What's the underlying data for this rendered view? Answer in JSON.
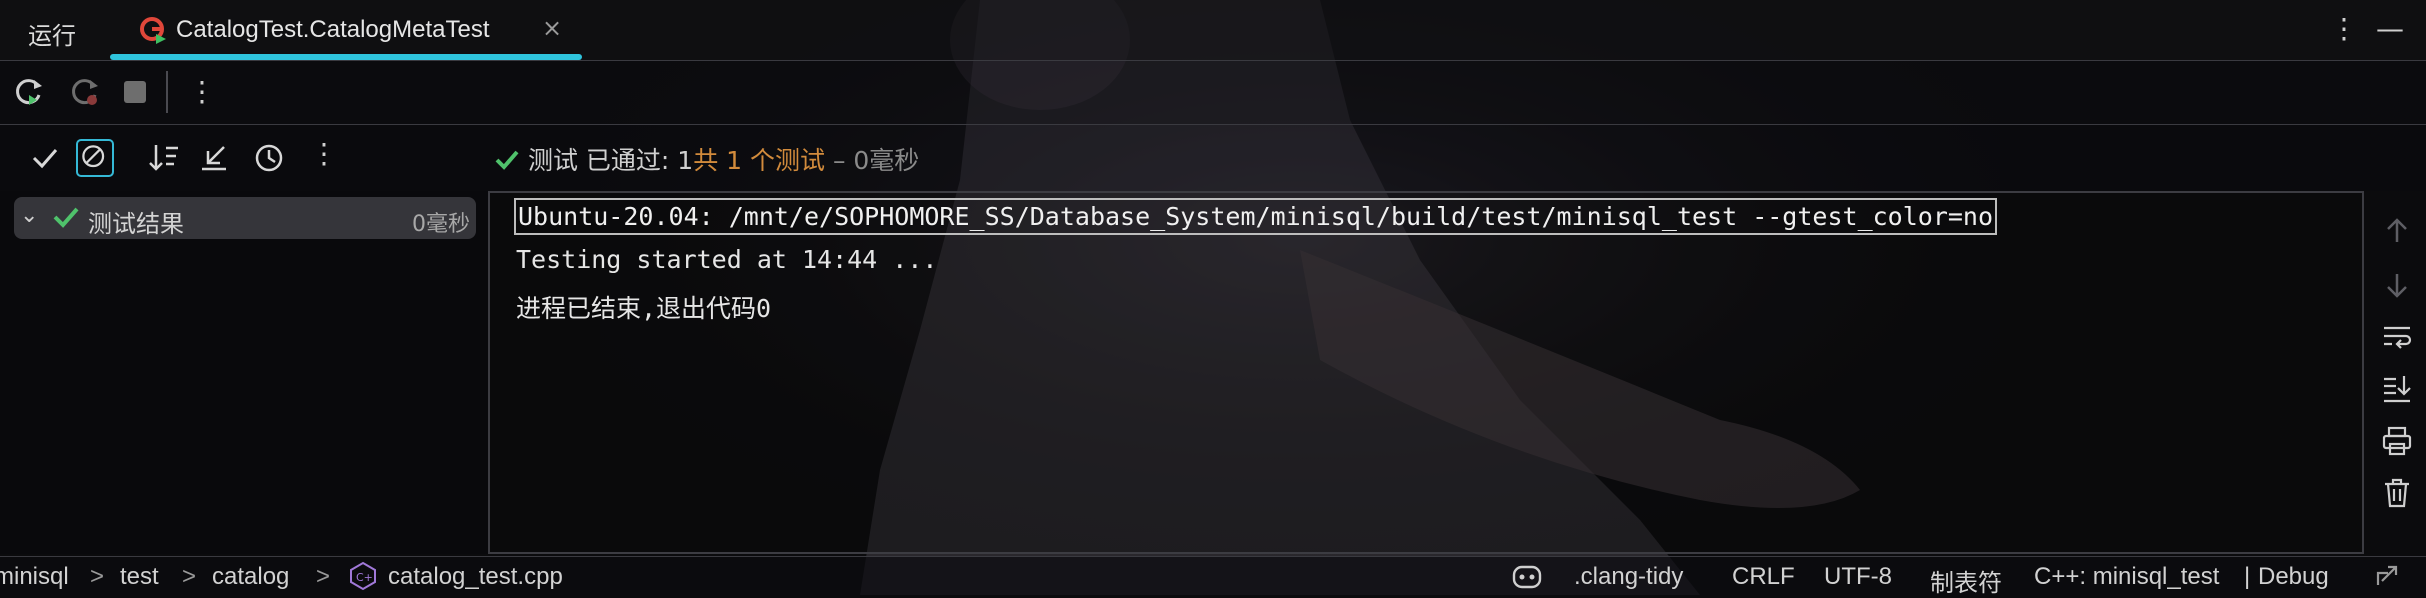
{
  "header": {
    "run_label": "运行",
    "tab_label": "CatalogTest.CatalogMetaTest",
    "tab_close": "×",
    "more_icon": "⋮",
    "minimize_icon": "—"
  },
  "toolbar": {
    "more_icon": "⋮"
  },
  "testbar": {
    "more_icon": "⋮",
    "status_passed": "测试 已通过: 1",
    "status_total": "共 1 个测试",
    "status_time": " – 0毫秒"
  },
  "tree": {
    "chevron": "⌄",
    "root_label": "测试结果",
    "root_time": "0毫秒"
  },
  "console": {
    "command": "Ubuntu-20.04: /mnt/e/SOPHOMORE_SS/Database_System/minisql/build/test/minisql_test --gtest_color=no",
    "line_started": "Testing started at 14:44 ...",
    "line_exit": "进程已结束,退出代码0"
  },
  "statusbar": {
    "breadcrumbs": [
      "minisql",
      "test",
      "catalog",
      "catalog_test.cpp"
    ],
    "separator": ">",
    "clang_tidy": ".clang-tidy",
    "line_ending": "CRLF",
    "encoding": "UTF-8",
    "indent": "制表符",
    "context": "C++: minisql_test",
    "context_sep": "|",
    "build_type": "Debug"
  },
  "colors": {
    "accent": "#2fc4dd",
    "success": "#4fc26b",
    "warning_orange": "#d28b3c"
  },
  "icons": {
    "toolbar": [
      "rerun-icon",
      "rerun-failed-icon",
      "stop-icon",
      "more-icon"
    ],
    "testbar": [
      "show-passed-icon",
      "show-ignored-icon",
      "sort-icon",
      "collapse-icon",
      "history-icon",
      "more-icon"
    ],
    "gutter": [
      "scroll-up-icon",
      "scroll-down-icon",
      "soft-wrap-icon",
      "scroll-to-end-icon",
      "print-icon",
      "clear-icon"
    ]
  }
}
